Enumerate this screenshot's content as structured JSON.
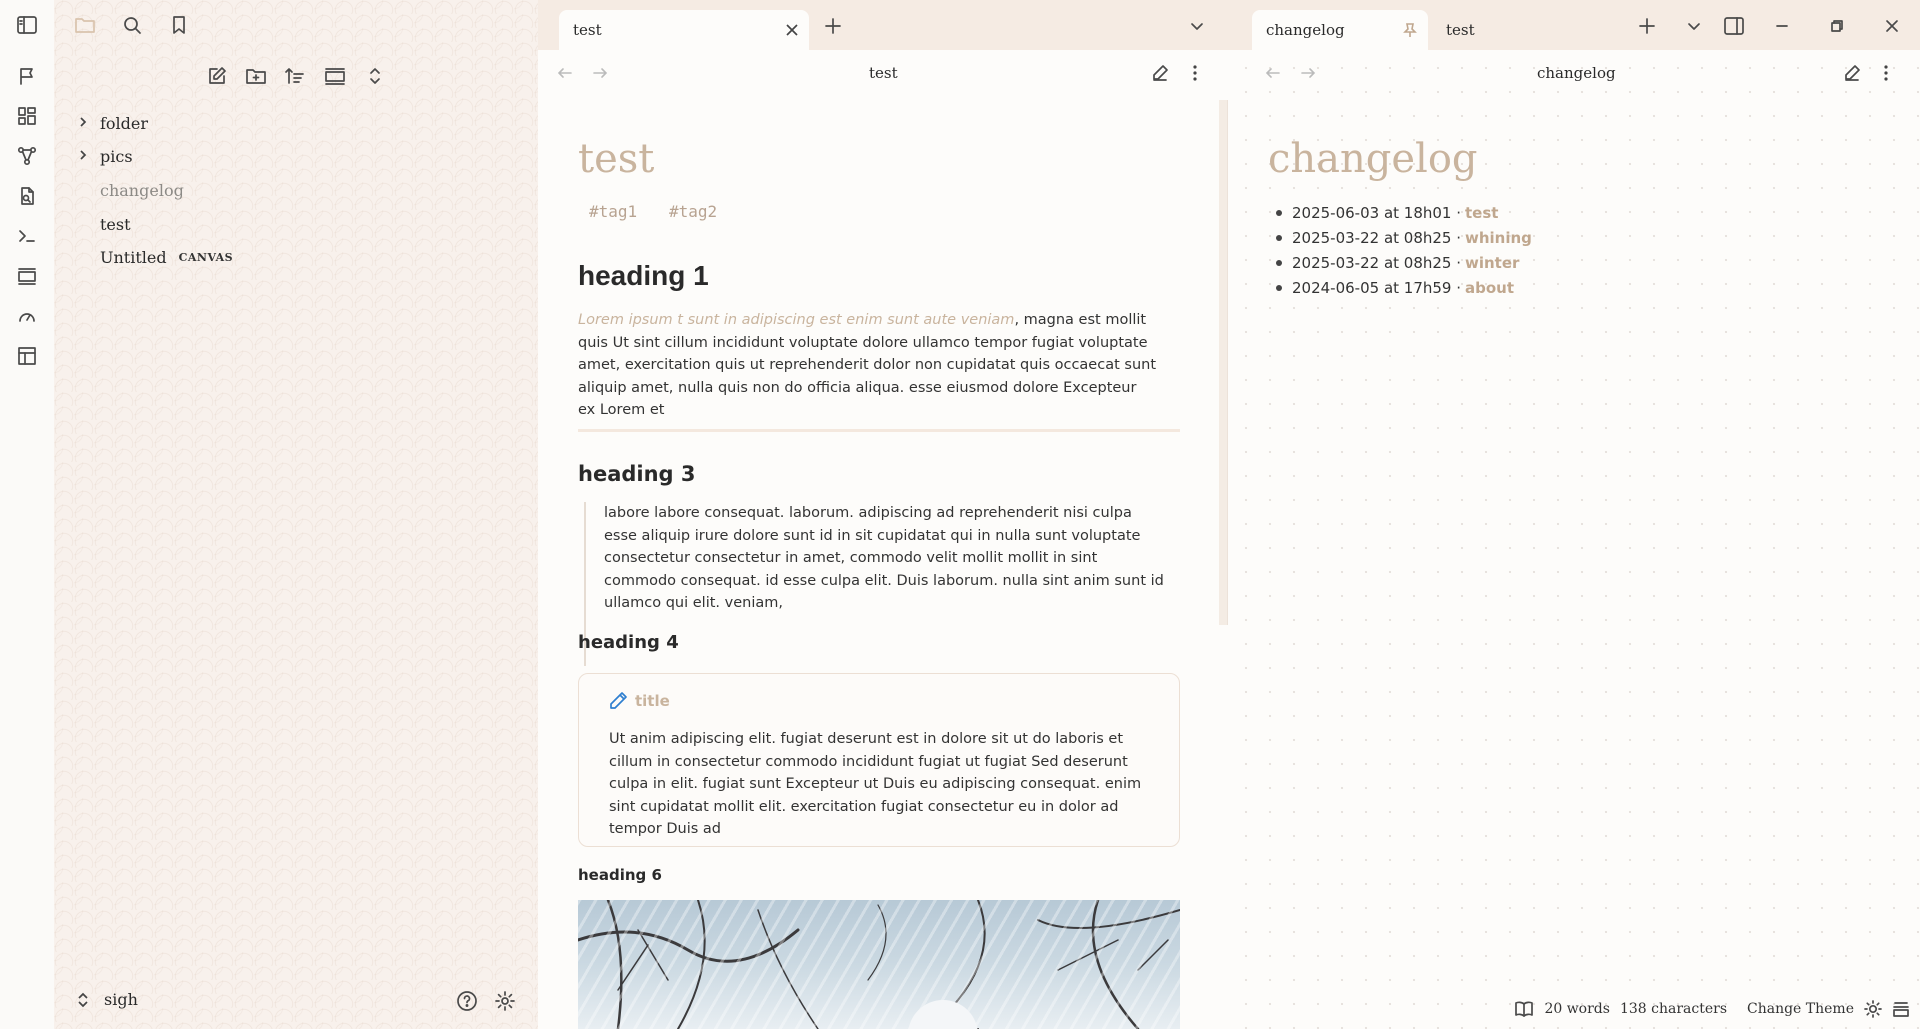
{
  "sidebar": {
    "tree": [
      {
        "label": "folder",
        "type": "folder"
      },
      {
        "label": "pics",
        "type": "folder"
      },
      {
        "label": "changelog",
        "type": "file"
      },
      {
        "label": "test",
        "type": "file"
      },
      {
        "label": "Untitled",
        "type": "file",
        "badge": "CANVAS"
      }
    ],
    "vault_name": "sigh"
  },
  "tabs": {
    "left": [
      {
        "label": "test",
        "active": true
      }
    ],
    "right": [
      {
        "label": "changelog",
        "active": true,
        "pinned": true
      },
      {
        "label": "test",
        "active": false
      }
    ]
  },
  "pane1": {
    "header_title": "test",
    "note_title": "test",
    "tags": [
      "#tag1",
      "#tag2"
    ],
    "heading1": "heading 1",
    "para1_em": "Lorem ipsum t sunt in adipiscing est enim sunt aute veniam",
    "para1_rest": ", magna est mollit quis Ut sint cillum incididunt voluptate dolore ullamco tempor fugiat voluptate amet, exercitation quis ut reprehenderit dolor non cupidatat quis occaecat sunt aliquip amet, nulla quis non do officia aliqua. esse eiusmod dolore Excepteur ex Lorem et",
    "heading3": "heading 3",
    "quote": "labore labore consequat. laborum. adipiscing ad reprehenderit nisi culpa esse aliquip irure dolore sunt id in sit cupidatat qui in nulla sunt voluptate consectetur consectetur in amet, commodo velit mollit mollit in sint commodo consequat. id esse culpa elit. Duis laborum. nulla sint anim sunt id ullamco qui elit. veniam,",
    "heading4": "heading 4",
    "callout_title": "title",
    "callout_body": "Ut anim adipiscing elit. fugiat deserunt est in dolore sit ut do laboris et cillum in consectetur commodo incididunt fugiat ut fugiat Sed deserunt culpa in elit. fugiat sunt Excepteur ut Duis eu adipiscing consequat. enim sint cupidatat mollit elit. exercitation fugiat consectetur eu in dolor ad tempor Duis ad",
    "heading6": "heading 6"
  },
  "pane2": {
    "header_title": "changelog",
    "note_title": "changelog",
    "entries": [
      {
        "date": "2025-06-03 at 18h01 ·",
        "link": "test"
      },
      {
        "date": "2025-03-22 at 08h25 ·",
        "link": "whining"
      },
      {
        "date": "2025-03-22 at 08h25 ·",
        "link": "winter"
      },
      {
        "date": "2024-06-05 at 17h59 ·",
        "link": "about"
      }
    ]
  },
  "status": {
    "words": "20 words",
    "characters": "138 characters",
    "theme": "Change Theme"
  },
  "colors": {
    "accent": "#c9b49e",
    "tabbar": "#f5ebe3",
    "sidebar": "#f8f1ec"
  }
}
